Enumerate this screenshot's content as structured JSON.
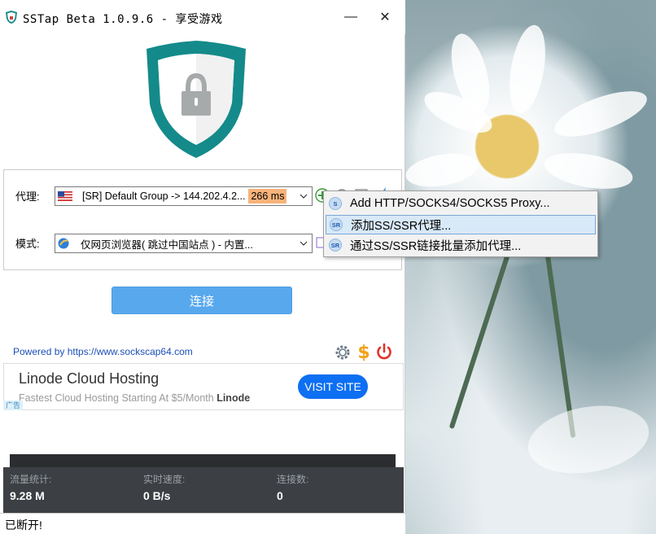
{
  "window": {
    "title": "SSTap Beta 1.0.9.6 - 享受游戏",
    "minimize_glyph": "—",
    "close_glyph": "✕"
  },
  "proxy": {
    "label": "代理:",
    "selected": "[SR] Default Group -> 144.202.4.2...",
    "latency": "266 ms",
    "flag_icon": "us-flag-icon"
  },
  "mode": {
    "label": "模式:",
    "selected": "仅网页浏览器( 跳过中国站点 ) - 内置..."
  },
  "connect_button": "连接",
  "powered_by": "Powered by https://www.sockscap64.com",
  "ad": {
    "title": "Linode Cloud Hosting",
    "subtitle": "Fastest Cloud Hosting Starting At $5/Month",
    "brand": "Linode",
    "cta": "VISIT SITE",
    "tag": "广告"
  },
  "stats": {
    "traffic_label": "流量统计:",
    "traffic_value": "9.28 M",
    "speed_label": "实时速度:",
    "speed_value": "0 B/s",
    "connections_label": "连接数:",
    "connections_value": "0"
  },
  "status": "已断开!",
  "context_menu": {
    "items": [
      {
        "label": "Add HTTP/SOCKS4/SOCKS5 Proxy...",
        "icon_text": "S"
      },
      {
        "label": "添加SS/SSR代理...",
        "icon_text": "SR"
      },
      {
        "label": "通过SS/SSR链接批量添加代理...",
        "icon_text": "SR"
      }
    ]
  },
  "colors": {
    "connect": "#58a8ee",
    "ad_cta": "#0d6ff2",
    "latency_badge": "#f7b27a",
    "stats_bg": "#3c3f43",
    "shield_teal": "#148a8a"
  }
}
